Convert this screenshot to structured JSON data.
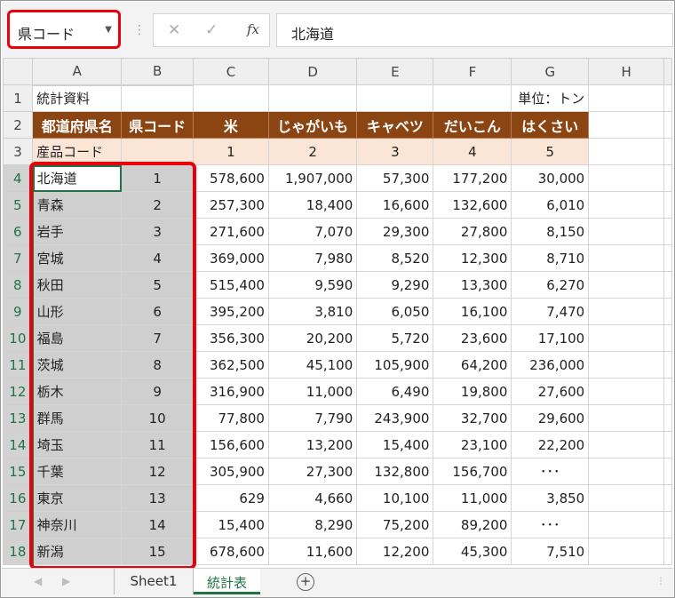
{
  "name_box": {
    "value": "県コード"
  },
  "formula_bar": {
    "cancel_glyph": "✕",
    "enter_glyph": "✓",
    "fx_label": "fx",
    "content": "北海道"
  },
  "columns": [
    "A",
    "B",
    "C",
    "D",
    "E",
    "F",
    "G",
    "H"
  ],
  "rows": [
    {
      "n": "1",
      "cells": [
        "統計資料",
        "",
        "",
        "",
        "",
        "",
        "単位：トン",
        ""
      ]
    },
    {
      "n": "2",
      "cells": [
        "都道府県名",
        "県コード",
        "米",
        "じゃがいも",
        "キャベツ",
        "だいこん",
        "はくさい",
        ""
      ]
    },
    {
      "n": "3",
      "cells": [
        "産品コード",
        "",
        "1",
        "2",
        "3",
        "4",
        "5",
        ""
      ]
    },
    {
      "n": "4",
      "cells": [
        "北海道",
        "1",
        "578,600",
        "1,907,000",
        "57,300",
        "177,200",
        "30,000",
        ""
      ]
    },
    {
      "n": "5",
      "cells": [
        "青森",
        "2",
        "257,300",
        "18,400",
        "16,600",
        "132,600",
        "6,010",
        ""
      ]
    },
    {
      "n": "6",
      "cells": [
        "岩手",
        "3",
        "271,600",
        "7,070",
        "29,300",
        "27,800",
        "8,150",
        ""
      ]
    },
    {
      "n": "7",
      "cells": [
        "宮城",
        "4",
        "369,000",
        "7,980",
        "8,520",
        "12,300",
        "8,710",
        ""
      ]
    },
    {
      "n": "8",
      "cells": [
        "秋田",
        "5",
        "515,400",
        "9,590",
        "9,290",
        "13,300",
        "6,270",
        ""
      ]
    },
    {
      "n": "9",
      "cells": [
        "山形",
        "6",
        "395,200",
        "3,810",
        "6,050",
        "16,100",
        "7,470",
        ""
      ]
    },
    {
      "n": "10",
      "cells": [
        "福島",
        "7",
        "356,300",
        "20,200",
        "5,720",
        "23,600",
        "17,100",
        ""
      ]
    },
    {
      "n": "11",
      "cells": [
        "茨城",
        "8",
        "362,500",
        "45,100",
        "105,900",
        "64,200",
        "236,000",
        ""
      ]
    },
    {
      "n": "12",
      "cells": [
        "栃木",
        "9",
        "316,900",
        "11,000",
        "6,490",
        "19,800",
        "27,600",
        ""
      ]
    },
    {
      "n": "13",
      "cells": [
        "群馬",
        "10",
        "77,800",
        "7,790",
        "243,900",
        "32,700",
        "29,600",
        ""
      ]
    },
    {
      "n": "14",
      "cells": [
        "埼玉",
        "11",
        "156,600",
        "13,200",
        "15,400",
        "23,100",
        "22,200",
        ""
      ]
    },
    {
      "n": "15",
      "cells": [
        "千葉",
        "12",
        "305,900",
        "27,300",
        "132,800",
        "156,700",
        "･･･",
        ""
      ]
    },
    {
      "n": "16",
      "cells": [
        "東京",
        "13",
        "629",
        "4,660",
        "10,100",
        "11,000",
        "3,850",
        ""
      ]
    },
    {
      "n": "17",
      "cells": [
        "神奈川",
        "14",
        "15,400",
        "8,290",
        "75,200",
        "89,200",
        "･･･",
        ""
      ]
    },
    {
      "n": "18",
      "cells": [
        "新潟",
        "15",
        "678,600",
        "11,600",
        "12,200",
        "45,300",
        "7,510",
        ""
      ]
    }
  ],
  "sheet_tabs": {
    "sheet1": "Sheet1",
    "sheet2": "統計表",
    "add": "+"
  },
  "colors": {
    "accent_green": "#217346",
    "header_brown": "#8b4513",
    "highlight_red": "#e8000b",
    "peach": "#fbe5d6"
  },
  "icons": {
    "namebox_dropdown": "chevron-down-icon",
    "add_sheet": "plus-circle-icon"
  }
}
